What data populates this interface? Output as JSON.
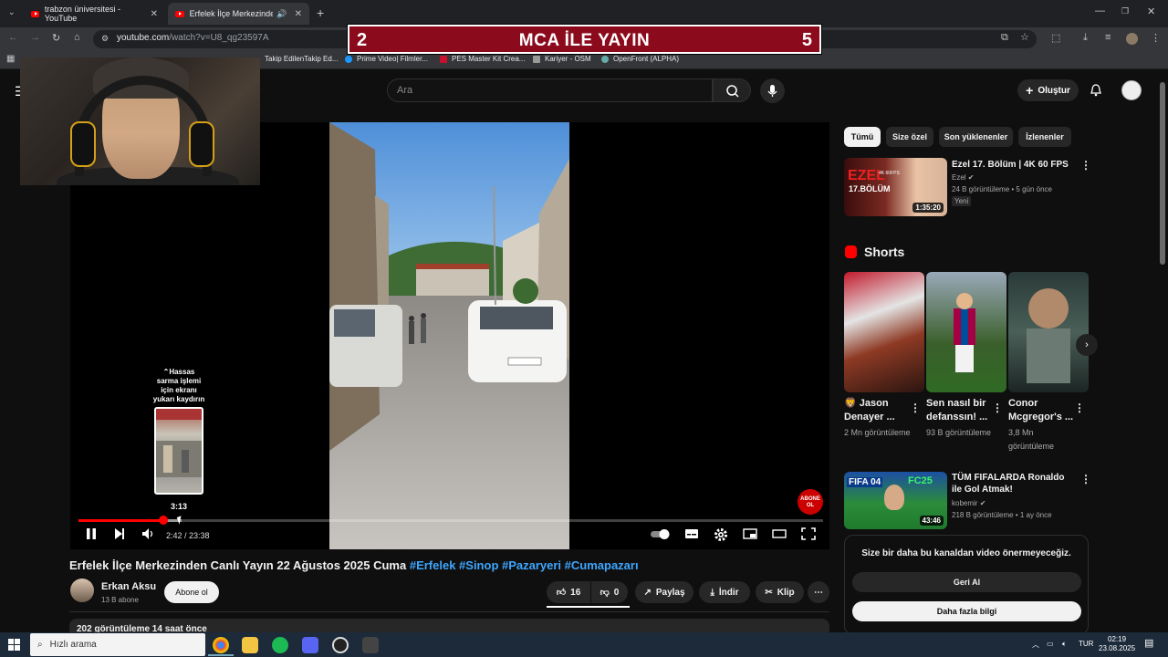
{
  "browser": {
    "tabs": [
      {
        "title": "trabzon üniversitesi - YouTube",
        "active": false
      },
      {
        "title": "Erfelek İlçe Merkezinden Ca",
        "active": true
      }
    ],
    "url_host": "youtube.com",
    "url_path": "/watch?v=U8_qg23597A",
    "bookmarks": [
      "Takip EdilenTakip Ed...",
      "Prime Video| Filmler...",
      "PES Master Kit Crea...",
      "Kariyer - OSM",
      "OpenFront (ALPHA)"
    ]
  },
  "overlay": {
    "left_num": "2",
    "title": "MCA İLE YAYIN",
    "right_num": "5"
  },
  "header": {
    "search_placeholder": "Ara",
    "create_label": "Oluştur"
  },
  "player": {
    "hint": "⌃Hassas sarma işlemi için ekranı yukarı kaydırın",
    "preview_time": "3:13",
    "time_text": "2:42 / 23:38",
    "progress_fraction": 0.114,
    "buffer_fraction": 0.139,
    "abone_label": "ABONE OL"
  },
  "video": {
    "title": "Erfelek İlçe Merkezinden Canlı Yayın 22 Ağustos 2025 Cuma",
    "hashtags": "#Erfelek #Sinop #Pazaryeri #Cumapazarı",
    "channel": "Erkan Aksu",
    "subs": "13 B abone",
    "subscribe": "Abone ol",
    "likes": "16",
    "dislikes": "0",
    "share": "Paylaş",
    "download": "İndir",
    "clip": "Klip",
    "desc_preview": "202 görüntüleme  14 saat önce"
  },
  "sidebar": {
    "chips": [
      "Tümü",
      "Size özel",
      "Son yüklenenler",
      "İzlenenler"
    ],
    "rec1": {
      "title": "Ezel 17. Bölüm | 4K 60 FPS",
      "channel": "Ezel",
      "meta": "24 B görüntüleme • 5 gün önce",
      "badge": "Yeni",
      "duration": "1:35:20",
      "thumb_text": "EZEL",
      "thumb_sub": "17.BÖLÜM",
      "thumb_badge": "4K 60FPS"
    },
    "shorts_title": "Shorts",
    "shorts": [
      {
        "title": "🦁 Jason Denayer ...",
        "views": "2 Mn görüntüleme"
      },
      {
        "title": "Sen nasıl bir defanssın! ...",
        "views": "93 B görüntüleme"
      },
      {
        "title": "Conor Mcgregor's ...",
        "views": "3,8 Mn görüntüleme"
      }
    ],
    "rec2": {
      "title": "TÜM FIFALARDA Ronaldo ile Gol Atmak!",
      "channel": "kobemir",
      "meta": "218 B görüntüleme • 1 ay önce",
      "duration": "43:46",
      "thumb_left": "FIFA 04",
      "thumb_right": "FC25"
    },
    "feedback_text": "Size bir daha bu kanaldan video önermeyeceğiz.",
    "undo": "Geri Al",
    "more_info": "Daha fazla bilgi"
  },
  "taskbar": {
    "search": "Hızlı arama",
    "lang": "TUR",
    "time": "02:19",
    "date": "23.08.2025"
  }
}
